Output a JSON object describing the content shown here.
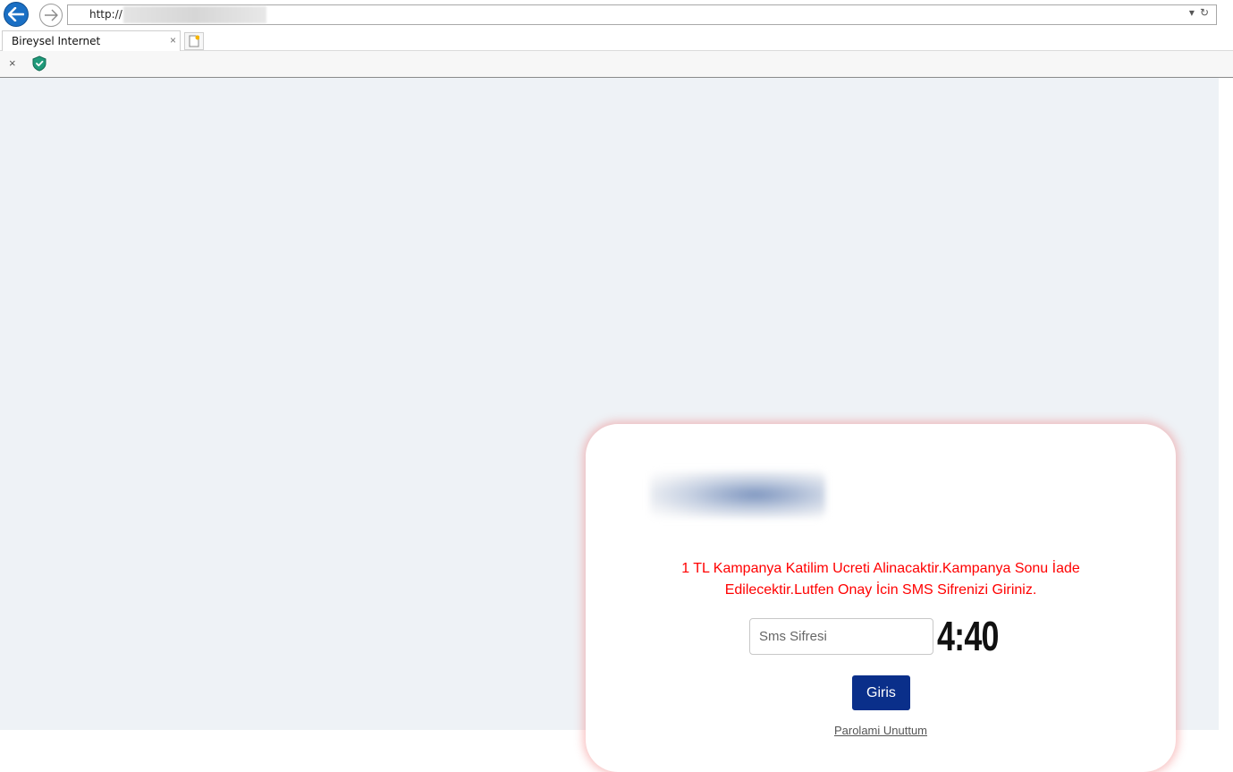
{
  "browser": {
    "address_text": "http://",
    "address_dropdown_icon": "chevron-down-icon",
    "refresh_icon": "refresh-icon",
    "tab_title": "Bireysel Internet",
    "tab_close": "×",
    "command_close": "×",
    "accent_color": "#1a6fc4"
  },
  "login_card": {
    "message": "1 TL Kampanya Katilim Ucreti Alinacaktir.Kampanya Sonu İade Edilecektir.Lutfen Onay İcin SMS Sifrenizi Giriniz.",
    "sms_placeholder": "Sms Sifresi",
    "sms_value": "",
    "timer": "4:40",
    "submit_label": "Giris",
    "forgot_label": "Parolami Unuttum",
    "message_color": "#ff0000",
    "button_color": "#0a2f8a"
  }
}
